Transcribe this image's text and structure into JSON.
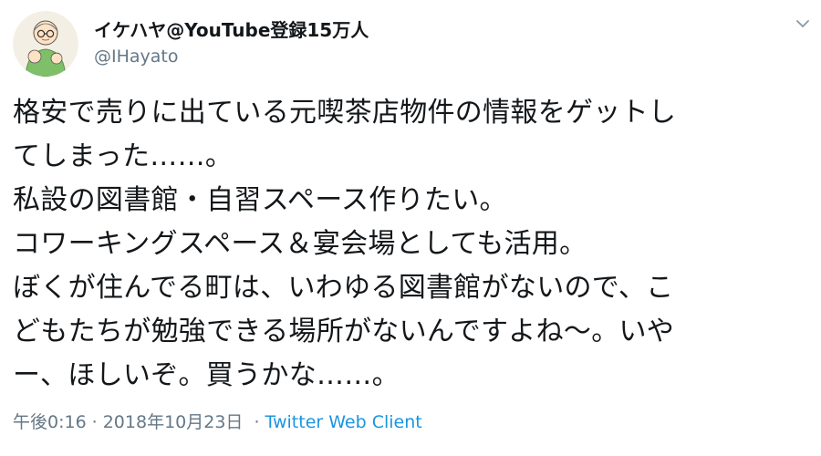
{
  "user": {
    "display_name": "イケハヤ@YouTube登録15万人",
    "handle": "@IHayato"
  },
  "tweet": {
    "lines": [
      "格安で売りに出ている元喫茶店物件の情報をゲットし",
      "てしまった……。",
      "私設の図書館・自習スペース作りたい。",
      "コワーキングスペース＆宴会場としても活用。",
      "ぼくが住んでる町は、いわゆる図書館がないので、こ",
      "どもたちが勉強できる場所がないんですよね〜。いや",
      "ー、ほしいぞ。買うかな……。"
    ]
  },
  "meta": {
    "time": "午後0:16",
    "separator": "·",
    "date": "2018年10月23日",
    "source": "Twitter Web Client"
  },
  "icons": {
    "avatar": "avatar-illustration",
    "menu": "chevron-down-icon"
  },
  "colors": {
    "text": "#14171a",
    "secondary": "#657786",
    "link": "#1b95e0",
    "background": "#ffffff"
  }
}
